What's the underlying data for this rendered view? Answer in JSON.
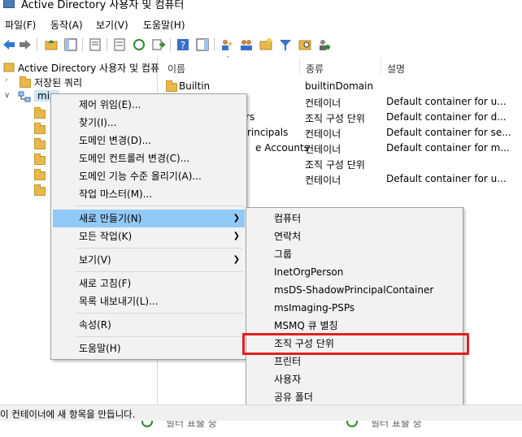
{
  "window": {
    "title": "Active Directory 사용자 및 컴퓨터"
  },
  "menubar": [
    {
      "label": "파일(F)"
    },
    {
      "label": "동작(A)"
    },
    {
      "label": "보기(V)"
    },
    {
      "label": "도움말(H)"
    }
  ],
  "toolbar": {
    "icons": [
      "back-icon",
      "forward-icon",
      "up-folder-icon",
      "console-tree-icon",
      "properties-icon",
      "export-list-icon",
      "refresh-icon",
      "export-icon",
      "help-icon",
      "action-pane-icon",
      "users-icon",
      "groups-icon",
      "ou-icon",
      "filter-icon",
      "find-icon",
      "delegate-icon"
    ]
  },
  "tree": {
    "root": "Active Directory 사용자 및 컴퓨터",
    "saved_queries": "저장된 쿼리",
    "domain": "min"
  },
  "list": {
    "columns": [
      "이름",
      "종류",
      "설명"
    ],
    "rows": [
      {
        "name": "Builtin",
        "type": "builtinDomain",
        "desc": ""
      },
      {
        "name": "",
        "type": "컨테이너",
        "desc": "Default container for u..."
      },
      {
        "name": "llers",
        "type": "조직 구성 단위",
        "desc": "Default container for d..."
      },
      {
        "name": "rincipals",
        "type": "컨테이너",
        "desc": "Default container for se..."
      },
      {
        "name": "e Accounts",
        "type": "컨테이너",
        "desc": "Default container for m..."
      },
      {
        "name": "",
        "type": "조직 구성 단위",
        "desc": ""
      },
      {
        "name": "",
        "type": "컨테이너",
        "desc": "Default container for u..."
      }
    ]
  },
  "context_menu": {
    "items": [
      "제어 위임(E)...",
      "찾기(I)...",
      "도메인 변경(D)...",
      "도메인 컨트롤러 변경(C)...",
      "도메인 기능 수준 올리기(A)...",
      "작업 마스터(M)...",
      "새로 만들기(N)",
      "모든 작업(K)",
      "보기(V)",
      "새로 고침(F)",
      "목록 내보내기(L)...",
      "속성(R)",
      "도움말(H)"
    ]
  },
  "submenu": {
    "items": [
      "컴퓨터",
      "연락처",
      "그룹",
      "InetOrgPerson",
      "msDS-ShadowPrincipalContainer",
      "msImaging-PSPs",
      "MSMQ 큐 별칭",
      "조직 구성 단위",
      "프린터",
      "사용자",
      "공유 폴더"
    ]
  },
  "statusbar": {
    "text": "이 컨테이너에 새 항목을 만듭니다."
  },
  "bottom": {
    "label1": "필터 표출 중",
    "label2": "필터 표출 중"
  },
  "colors": {
    "highlight": "#91c9f7",
    "annotation_box": "#e02020"
  }
}
